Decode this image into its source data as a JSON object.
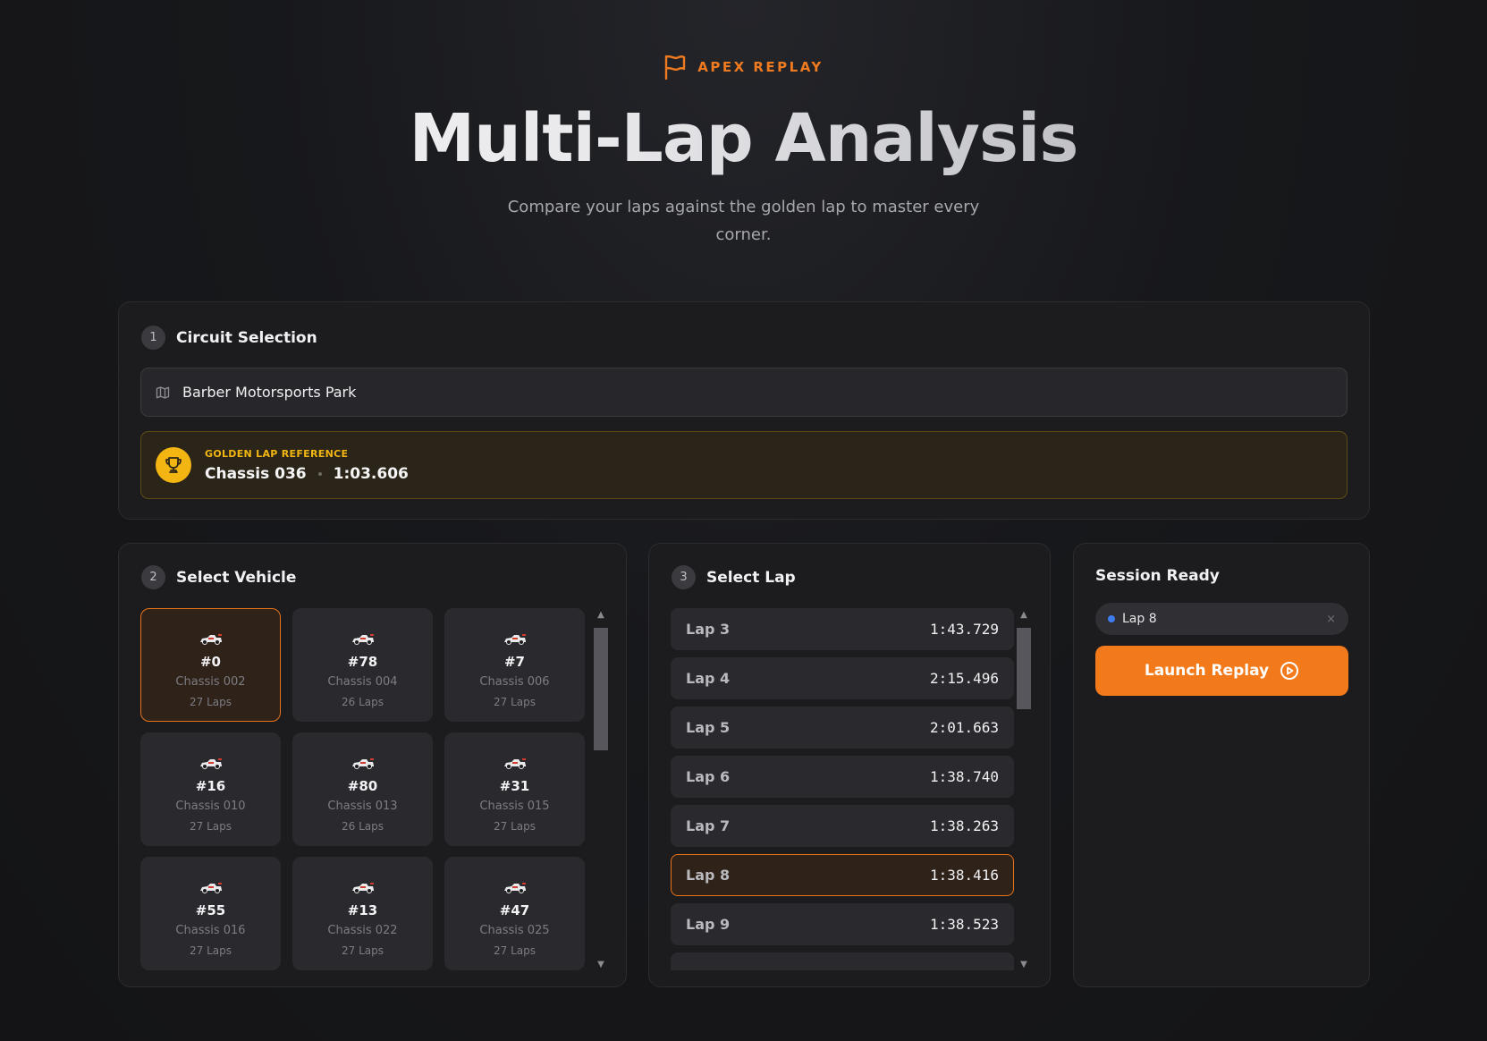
{
  "brand": {
    "name": "APEX REPLAY",
    "icon": "flag-icon",
    "accent": "#f07a1f"
  },
  "header": {
    "title": "Multi-Lap Analysis",
    "subtitle": "Compare your laps against the golden lap to master every corner."
  },
  "circuit": {
    "step": "1",
    "title": "Circuit Selection",
    "selected": "Barber Motorsports Park",
    "golden": {
      "label": "GOLDEN LAP REFERENCE",
      "chassis": "Chassis 036",
      "time": "1:03.606"
    }
  },
  "vehicles": {
    "step": "2",
    "title": "Select Vehicle",
    "items": [
      {
        "number": "#0",
        "chassis": "Chassis 002",
        "laps": "27 Laps",
        "selected": true
      },
      {
        "number": "#78",
        "chassis": "Chassis 004",
        "laps": "26 Laps",
        "selected": false
      },
      {
        "number": "#7",
        "chassis": "Chassis 006",
        "laps": "27 Laps",
        "selected": false
      },
      {
        "number": "#16",
        "chassis": "Chassis 010",
        "laps": "27 Laps",
        "selected": false
      },
      {
        "number": "#80",
        "chassis": "Chassis 013",
        "laps": "26 Laps",
        "selected": false
      },
      {
        "number": "#31",
        "chassis": "Chassis 015",
        "laps": "27 Laps",
        "selected": false
      },
      {
        "number": "#55",
        "chassis": "Chassis 016",
        "laps": "27 Laps",
        "selected": false
      },
      {
        "number": "#13",
        "chassis": "Chassis 022",
        "laps": "27 Laps",
        "selected": false
      },
      {
        "number": "#47",
        "chassis": "Chassis 025",
        "laps": "27 Laps",
        "selected": false
      }
    ]
  },
  "laps": {
    "step": "3",
    "title": "Select Lap",
    "items": [
      {
        "name": "Lap 3",
        "time": "1:43.729",
        "selected": false
      },
      {
        "name": "Lap 4",
        "time": "2:15.496",
        "selected": false
      },
      {
        "name": "Lap 5",
        "time": "2:01.663",
        "selected": false
      },
      {
        "name": "Lap 6",
        "time": "1:38.740",
        "selected": false
      },
      {
        "name": "Lap 7",
        "time": "1:38.263",
        "selected": false
      },
      {
        "name": "Lap 8",
        "time": "1:38.416",
        "selected": true
      },
      {
        "name": "Lap 9",
        "time": "1:38.523",
        "selected": false
      },
      {
        "name": "",
        "time": "",
        "selected": false
      }
    ]
  },
  "session": {
    "title": "Session Ready",
    "chip_label": "Lap 8",
    "chip_close": "×",
    "launch_label": "Launch Replay"
  }
}
